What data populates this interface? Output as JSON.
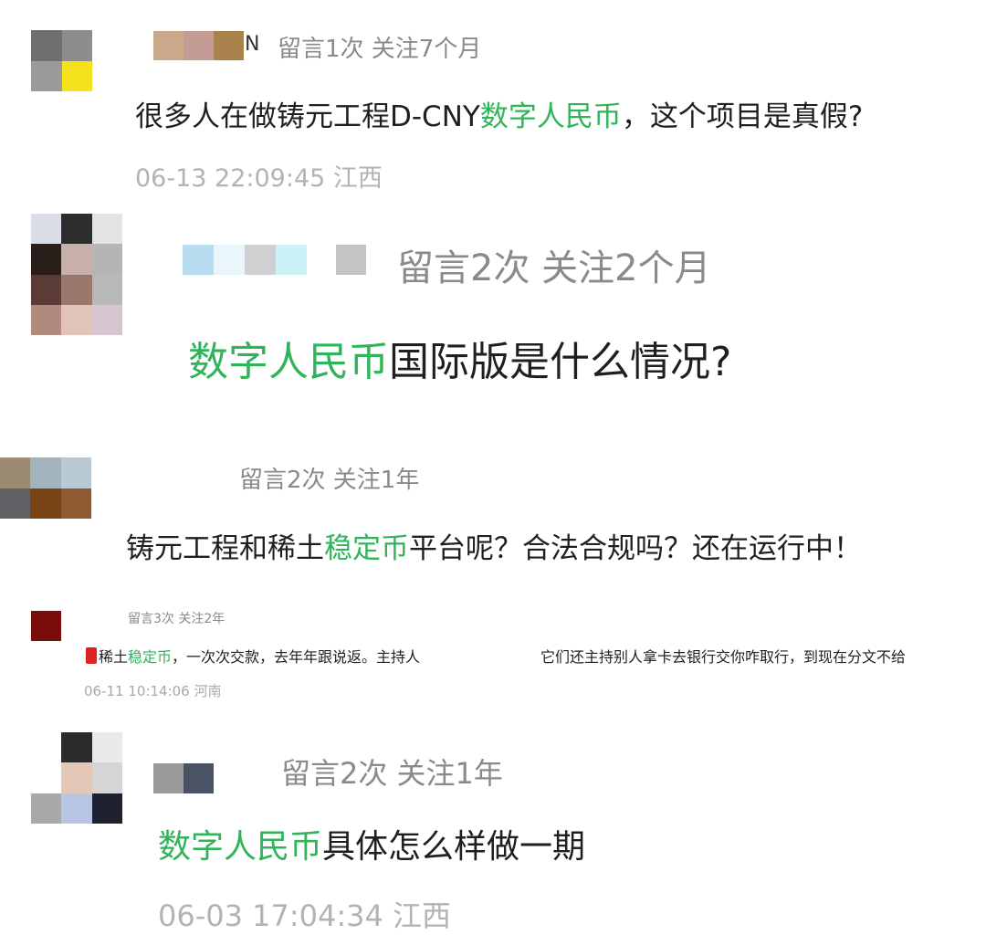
{
  "comments": [
    {
      "avatar": {
        "cols": 2,
        "colors": [
          "#6f6f6f",
          "#8d8d8d",
          "#9a9a9a",
          "#f4e21c"
        ]
      },
      "name_blur": [
        "#c9a98a",
        "#c49b95",
        "#a9824e"
      ],
      "name_tail": "N",
      "meta": "留言1次 关注7个月",
      "text_parts": [
        {
          "text": "很多人在做铸元工程D-CNY",
          "hl": false
        },
        {
          "text": "数字人民币",
          "hl": true
        },
        {
          "text": "，这个项目是真假?",
          "hl": false
        }
      ],
      "time": "06-13 22:09:45 江西"
    },
    {
      "avatar": {
        "cols": 3,
        "colors": [
          "#d9dde6",
          "#2c2c2c",
          "#e3e3e3",
          "#2a1e1a",
          "#c7b0a9",
          "#b5b5b5",
          "#5a3b35",
          "#9a776b",
          "#b8b8b8",
          "#b08a7c",
          "#e0c3bb",
          "#d7c5cf"
        ]
      },
      "name_blur": [
        "#b9ddf0",
        "#e9f6fb",
        "#cfd0d2",
        "#cbf2f6"
      ],
      "name_blur2": "#c4c4c4",
      "meta": "留言2次 关注2个月",
      "text_parts": [
        {
          "text": "数字人民币",
          "hl": true
        },
        {
          "text": "国际版是什么情况?",
          "hl": false
        }
      ]
    },
    {
      "avatar": {
        "cols": 3,
        "colors": [
          "#9c8b72",
          "#a3b3bd",
          "#b9c9d3",
          "#606266",
          "#7a4416",
          "#8f5a32"
        ]
      },
      "meta": "留言2次 关注1年",
      "text_parts": [
        {
          "text": "铸元工程和稀土",
          "hl": false
        },
        {
          "text": "稳定币",
          "hl": true
        },
        {
          "text": "平台呢？合法合规吗？还在运行中！",
          "hl": false
        }
      ]
    },
    {
      "avatar": {
        "cols": 1,
        "colors": [
          "#7b0c0c"
        ]
      },
      "meta": "留言3次 关注2年",
      "text_parts": [
        {
          "text": "稀土",
          "hl": false
        },
        {
          "text": "稳定币",
          "hl": true
        },
        {
          "text": "，一次次交款，去年年跟说返。主持人",
          "hl": false
        }
      ],
      "text_tail": "它们还主持别人拿卡去银行交你咋取行，到现在分文不给",
      "time": "06-11 10:14:06 河南"
    },
    {
      "avatar": {
        "cols": 3,
        "colors": [
          "#ffffff",
          "#2b2b2b",
          "#e9e9e9",
          "#ffffff",
          "#e3c8b7",
          "#d5d5d5",
          "#a9a9a9",
          "#b9c6e3",
          "#1e2230"
        ]
      },
      "name_blur": [
        "#9b9b9b",
        "#4a5363"
      ],
      "meta": "留言2次 关注1年",
      "text_parts": [
        {
          "text": "数字人民币",
          "hl": true
        },
        {
          "text": "具体怎么样做一期",
          "hl": false
        }
      ],
      "time": "06-03 17:04:34 江西"
    }
  ]
}
